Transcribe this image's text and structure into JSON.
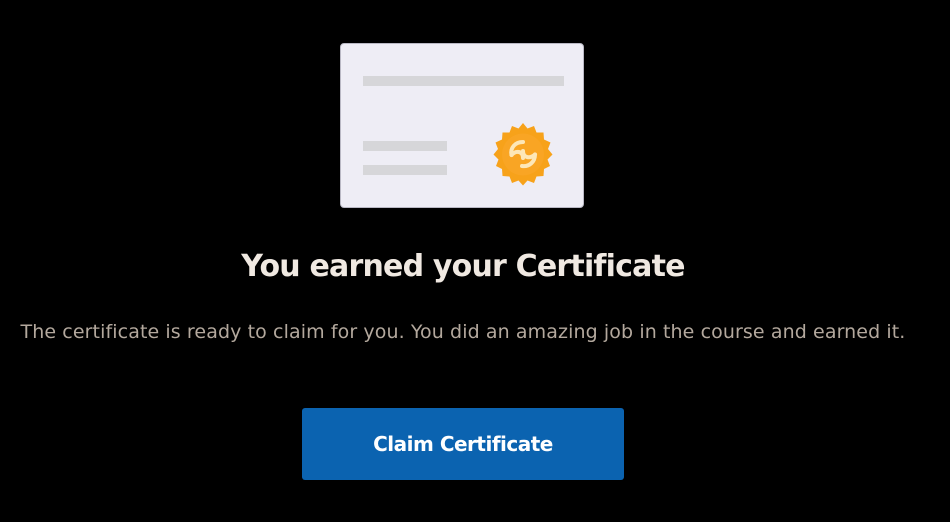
{
  "certificate": {
    "title": "You earned your Certificate",
    "description": "The certificate is ready to claim for you. You did an amazing job in the course and earned it.",
    "claim_button_label": "Claim Certificate",
    "badge_icon": "award-seal-icon"
  },
  "colors": {
    "background": "#000000",
    "card": "#eeedf5",
    "placeholder_lines": "#d6d6d9",
    "badge": "#f7a21a",
    "title_text": "#f0e9e2",
    "description_text": "#b3a89d",
    "button": "#0b63b0",
    "button_text": "#ffffff"
  }
}
